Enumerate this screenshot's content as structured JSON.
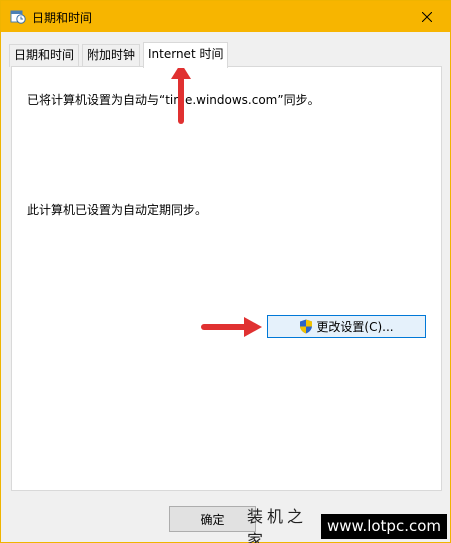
{
  "window": {
    "title": "日期和时间",
    "app_icon": "date-time-icon",
    "close_icon": "close-icon"
  },
  "tabs": [
    {
      "label": "日期和时间",
      "active": false
    },
    {
      "label": "附加时钟",
      "active": false
    },
    {
      "label": "Internet 时间",
      "active": true
    }
  ],
  "panel": {
    "sync_text": "已将计算机设置为自动与“time.windows.com”同步。",
    "auto_text": "此计算机已设置为自动定期同步。",
    "change_button_label": "更改设置(C)...",
    "change_button_icon": "uac-shield-icon"
  },
  "footer": {
    "ok_label": "确定"
  },
  "watermark": {
    "left": "装机之家",
    "right": "www.lotpc.com"
  },
  "colors": {
    "titlebar": "#f7b500",
    "annotation_arrow": "#e03131",
    "button_focus": "#0078d7"
  }
}
